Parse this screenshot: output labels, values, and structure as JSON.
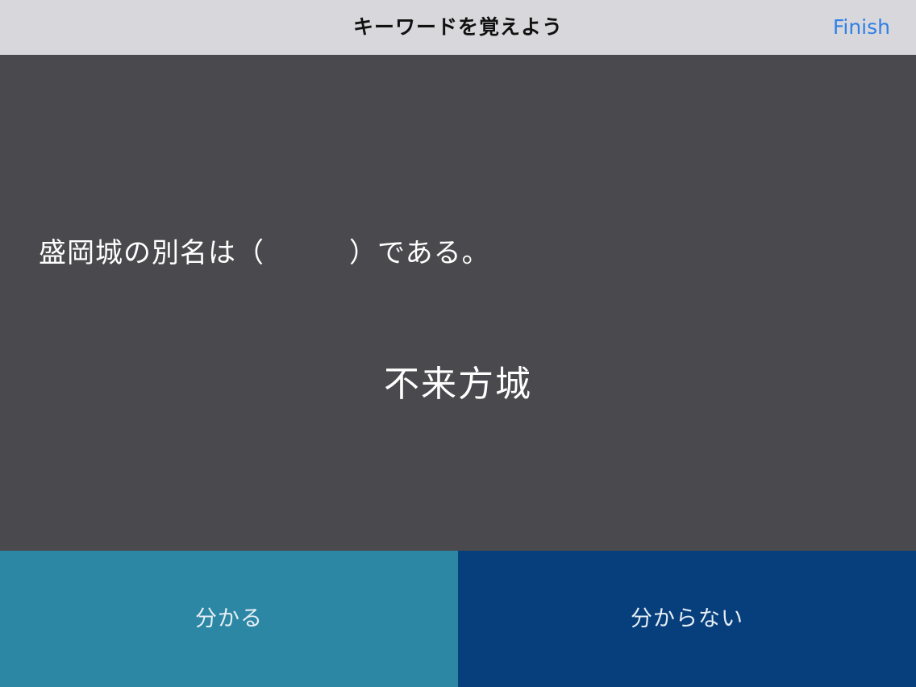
{
  "nav": {
    "title": "キーワードを覚えよう",
    "finish_label": "Finish"
  },
  "card": {
    "question": "盛岡城の別名は（　　　）である。",
    "answer": "不来方城"
  },
  "actions": {
    "know_label": "分かる",
    "dont_know_label": "分からない"
  },
  "colors": {
    "nav_background": "#d8d8dc",
    "card_background": "#4a494d",
    "know_button": "#2c87a5",
    "dont_know_button": "#073f7c",
    "link_accent": "#2f7fe6"
  }
}
